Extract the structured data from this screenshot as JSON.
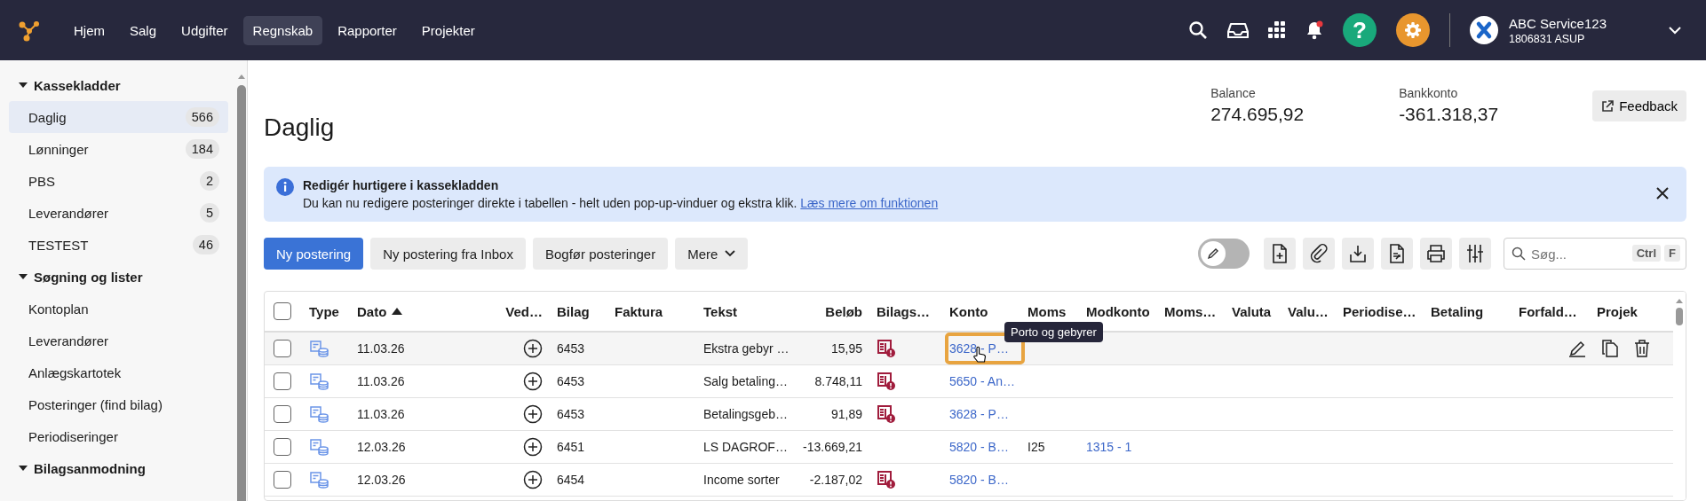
{
  "topbar": {
    "nav": [
      {
        "label": "Hjem",
        "selected": false
      },
      {
        "label": "Salg",
        "selected": false
      },
      {
        "label": "Udgifter",
        "selected": false
      },
      {
        "label": "Regnskab",
        "selected": true
      },
      {
        "label": "Rapporter",
        "selected": false
      },
      {
        "label": "Projekter",
        "selected": false
      }
    ],
    "notification": true,
    "help_label": "?",
    "account": {
      "name": "ABC Service123",
      "number": "1806831 ASUP"
    }
  },
  "sidebar": {
    "sections": [
      {
        "title": "Kassekladder",
        "expanded": true,
        "items": [
          {
            "label": "Daglig",
            "count": "566",
            "selected": true
          },
          {
            "label": "Lønninger",
            "count": "184",
            "selected": false
          },
          {
            "label": "PBS",
            "count": "2",
            "selected": false
          },
          {
            "label": "Leverandører",
            "count": "5",
            "selected": false
          },
          {
            "label": "TESTEST",
            "count": "46",
            "selected": false
          }
        ]
      },
      {
        "title": "Søgning og lister",
        "expanded": true,
        "items": [
          {
            "label": "Kontoplan",
            "selected": false
          },
          {
            "label": "Leverandører",
            "selected": false
          },
          {
            "label": "Anlægskartotek",
            "selected": false
          },
          {
            "label": "Posteringer (find bilag)",
            "selected": false
          },
          {
            "label": "Periodiseringer",
            "selected": false
          }
        ]
      },
      {
        "title": "Bilagsanmodning",
        "expanded": true
      }
    ]
  },
  "header": {
    "title": "Daglig",
    "stats": [
      {
        "label": "Balance",
        "value": "274.695,92"
      },
      {
        "label": "Bankkonto",
        "value": "-361.318,37"
      }
    ],
    "feedback": "Feedback"
  },
  "banner": {
    "title": "Redigér hurtigere i kassekladden",
    "text": "Du kan nu redigere posteringer direkte i tabellen - helt uden pop-up-vinduer og ekstra klik.",
    "link": "Læs mere om funktionen"
  },
  "toolbar": {
    "buttons": [
      {
        "label": "Ny postering",
        "kind": "primary"
      },
      {
        "label": "Ny postering fra Inbox",
        "kind": "plain"
      },
      {
        "label": "Bogfør posteringer",
        "kind": "plain"
      },
      {
        "label": "Mere",
        "kind": "menu"
      }
    ],
    "edit_mode": false,
    "search": {
      "placeholder": "Søg...",
      "keys": [
        "Ctrl",
        "F"
      ]
    }
  },
  "table": {
    "columns": [
      {
        "label": "Type",
        "sorted": false
      },
      {
        "label": "Dato",
        "sorted": true
      },
      {
        "label": "Ved…",
        "sorted": false
      },
      {
        "label": "Bilag",
        "sorted": false
      },
      {
        "label": "Faktura",
        "sorted": false
      },
      {
        "label": "Tekst",
        "sorted": false
      },
      {
        "label": "Beløb",
        "sorted": false
      },
      {
        "label": "Bilags…",
        "sorted": false
      },
      {
        "label": "Konto",
        "sorted": false
      },
      {
        "label": "Moms",
        "sorted": false
      },
      {
        "label": "Modkonto",
        "sorted": false
      },
      {
        "label": "Moms…",
        "sorted": false
      },
      {
        "label": "Valuta",
        "sorted": false
      },
      {
        "label": "Valu…",
        "sorted": false
      },
      {
        "label": "Periodise…",
        "sorted": false
      },
      {
        "label": "Betaling",
        "sorted": false
      },
      {
        "label": "Forfald…",
        "sorted": false
      },
      {
        "label": "Projek",
        "sorted": false
      }
    ],
    "all_checked": false,
    "tooltip": "Porto og gebyrer",
    "rows": [
      {
        "checked": false,
        "hovered": true,
        "dato": "11.03.26",
        "bilag": "6453",
        "tekst": "Ekstra gebyr …",
        "belob": "15,95",
        "bilags_missing": true,
        "konto": "3628 - P…",
        "konto_focused": true
      },
      {
        "checked": false,
        "hovered": false,
        "dato": "11.03.26",
        "bilag": "6453",
        "tekst": "Salg betaling…",
        "belob": "8.748,11",
        "bilags_missing": true,
        "konto": "5650 - An…",
        "konto_focused": false
      },
      {
        "checked": false,
        "hovered": false,
        "dato": "11.03.26",
        "bilag": "6453",
        "tekst": "Betalingsgeb…",
        "belob": "91,89",
        "bilags_missing": true,
        "konto": "3628 - P…",
        "konto_focused": false
      },
      {
        "checked": false,
        "hovered": false,
        "dato": "12.03.26",
        "bilag": "6451",
        "tekst": "LS DAGROF…",
        "belob": "-13.669,21",
        "bilags_missing": false,
        "konto": "5820 - B…",
        "konto_focused": false,
        "moms": "I25",
        "modkonto": "1315 - 1"
      },
      {
        "checked": false,
        "hovered": false,
        "dato": "12.03.26",
        "bilag": "6454",
        "tekst": "Income sorter",
        "belob": "-2.187,02",
        "bilags_missing": true,
        "konto": "5820 - B…",
        "konto_focused": false
      }
    ]
  }
}
